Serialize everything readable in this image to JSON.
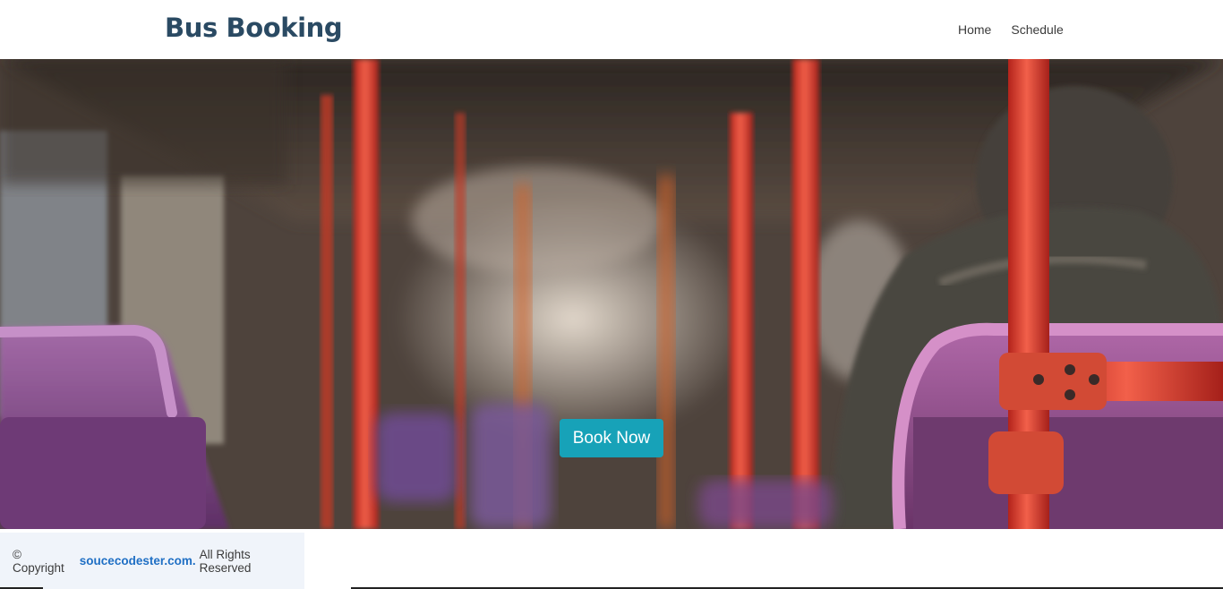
{
  "header": {
    "brand": "Bus Booking",
    "nav": [
      {
        "label": "Home"
      },
      {
        "label": "Schedule"
      }
    ]
  },
  "hero": {
    "button_label": "Book Now",
    "image_description": "interior-of-bus-photo"
  },
  "footer": {
    "prefix": "© Copyright",
    "link": "soucecodester.com.",
    "suffix": "All Rights Reserved"
  },
  "colors": {
    "brand": "#2a4a63",
    "button": "#17a2b8",
    "footer_link": "#1f6fc4",
    "footer_bg": "#f0f4fa"
  }
}
